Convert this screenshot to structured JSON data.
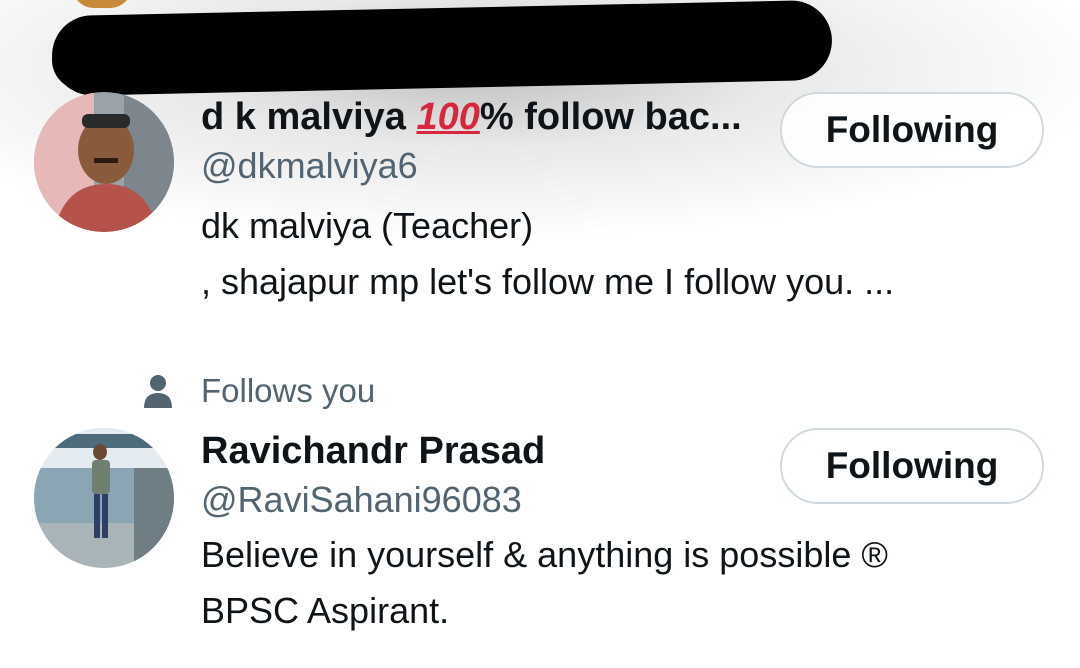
{
  "users": [
    {
      "name_prefix": "d k malviya ",
      "name_emoji": "100",
      "name_suffix": "% follow bac...",
      "handle": "@dkmalviya6",
      "bio_lines": [
        "dk malviya (Teacher)",
        ", shajapur mp let's follow me I follow you. ..."
      ],
      "button_label": "Following",
      "avatar_icon": "profile-photo-man-in-red-shirt"
    },
    {
      "follows_you_label": "Follows you",
      "follows_you_icon": "person-icon",
      "name": "Ravichandr Prasad",
      "handle": "@RaviSahani96083",
      "bio_lines": [
        "Believe in yourself & anything is possible   ®",
        "BPSC Aspirant."
      ],
      "button_label": "Following",
      "avatar_icon": "profile-photo-man-at-riverside"
    }
  ],
  "colors": {
    "text_primary": "#0f1419",
    "text_secondary": "#536471",
    "button_border": "#cfd9de",
    "redaction": "#000000"
  }
}
